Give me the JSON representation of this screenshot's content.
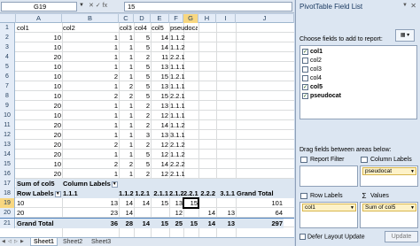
{
  "formula_bar": {
    "name_box": "G19",
    "fx_icons": "✕ ✓ fx",
    "value": "15"
  },
  "columns": [
    "A",
    "B",
    "C",
    "D",
    "E",
    "F",
    "G",
    "H",
    "I",
    "J"
  ],
  "rows": [
    {
      "n": "1",
      "cells": [
        "col1",
        "col2",
        "col3",
        "col4",
        "col5",
        "pseudocat"
      ]
    },
    {
      "n": "2",
      "cells": [
        "10",
        "1",
        "1",
        "5",
        "14",
        "1.1.2"
      ]
    },
    {
      "n": "3",
      "cells": [
        "10",
        "1",
        "1",
        "5",
        "14",
        "1.1.2"
      ]
    },
    {
      "n": "4",
      "cells": [
        "20",
        "1",
        "1",
        "2",
        "11",
        "2.2.1"
      ]
    },
    {
      "n": "5",
      "cells": [
        "10",
        "1",
        "1",
        "5",
        "13",
        "1.1.1"
      ]
    },
    {
      "n": "6",
      "cells": [
        "10",
        "2",
        "1",
        "5",
        "15",
        "1.2.1"
      ]
    },
    {
      "n": "7",
      "cells": [
        "10",
        "1",
        "2",
        "5",
        "13",
        "1.1.1"
      ]
    },
    {
      "n": "8",
      "cells": [
        "10",
        "2",
        "2",
        "5",
        "15",
        "2.2.1"
      ]
    },
    {
      "n": "9",
      "cells": [
        "20",
        "1",
        "1",
        "2",
        "13",
        "1.1.1"
      ]
    },
    {
      "n": "10",
      "cells": [
        "10",
        "1",
        "1",
        "2",
        "12",
        "1.1.1"
      ]
    },
    {
      "n": "11",
      "cells": [
        "20",
        "1",
        "1",
        "2",
        "14",
        "1.1.2"
      ]
    },
    {
      "n": "12",
      "cells": [
        "20",
        "1",
        "1",
        "3",
        "13",
        "3.1.1"
      ]
    },
    {
      "n": "13",
      "cells": [
        "20",
        "2",
        "1",
        "2",
        "12",
        "2.1.2"
      ]
    },
    {
      "n": "14",
      "cells": [
        "20",
        "1",
        "1",
        "5",
        "12",
        "1.1.2"
      ]
    },
    {
      "n": "15",
      "cells": [
        "10",
        "2",
        "2",
        "5",
        "14",
        "2.2.2"
      ]
    },
    {
      "n": "16",
      "cells": [
        "20",
        "1",
        "1",
        "2",
        "12",
        "2.1.1"
      ]
    }
  ],
  "pivot": {
    "row17": {
      "n": "17",
      "a": "Sum of col5",
      "b": "Column Labels"
    },
    "row18": {
      "n": "18",
      "a": "Row Labels",
      "b": "1.1.1",
      "cols": [
        "1.1.2",
        "1.2.1",
        "2.1.1",
        "2.1.2",
        "2.2.1",
        "2.2.2",
        "3.1.1",
        "Grand Total"
      ]
    },
    "row19": {
      "n": "19",
      "a": "10",
      "b": "13",
      "cols": [
        "14",
        "14",
        "15",
        "13",
        "15",
        "",
        "",
        "101"
      ]
    },
    "row20": {
      "n": "20",
      "a": "20",
      "b": "23",
      "cols": [
        "14",
        "",
        "",
        "12",
        "",
        "14",
        "13",
        "64"
      ]
    },
    "row21": {
      "n": "21",
      "a": "Grand Total",
      "b": "36",
      "cols": [
        "28",
        "14",
        "15",
        "25",
        "15",
        "14",
        "13",
        "297"
      ]
    }
  },
  "sheet_tabs": [
    "Sheet1",
    "Sheet2",
    "Sheet3"
  ],
  "field_list": {
    "title": "PivotTable Field List",
    "choose_label": "Choose fields to add to report:",
    "fields": [
      {
        "label": "col1",
        "checked": "✓"
      },
      {
        "label": "col2",
        "checked": ""
      },
      {
        "label": "col3",
        "checked": ""
      },
      {
        "label": "col4",
        "checked": ""
      },
      {
        "label": "col5",
        "checked": "✓"
      },
      {
        "label": "pseudocat",
        "checked": "✓"
      }
    ],
    "drag_label": "Drag fields between areas below:",
    "report_filter": "Report Filter",
    "column_labels": "Column Labels",
    "column_chip": "pseudocat",
    "row_labels": "Row Labels",
    "row_chip": "col1",
    "values": "Values",
    "values_chip": "Sum of col5",
    "defer_label": "Defer Layout Update",
    "update_button": "Update"
  }
}
